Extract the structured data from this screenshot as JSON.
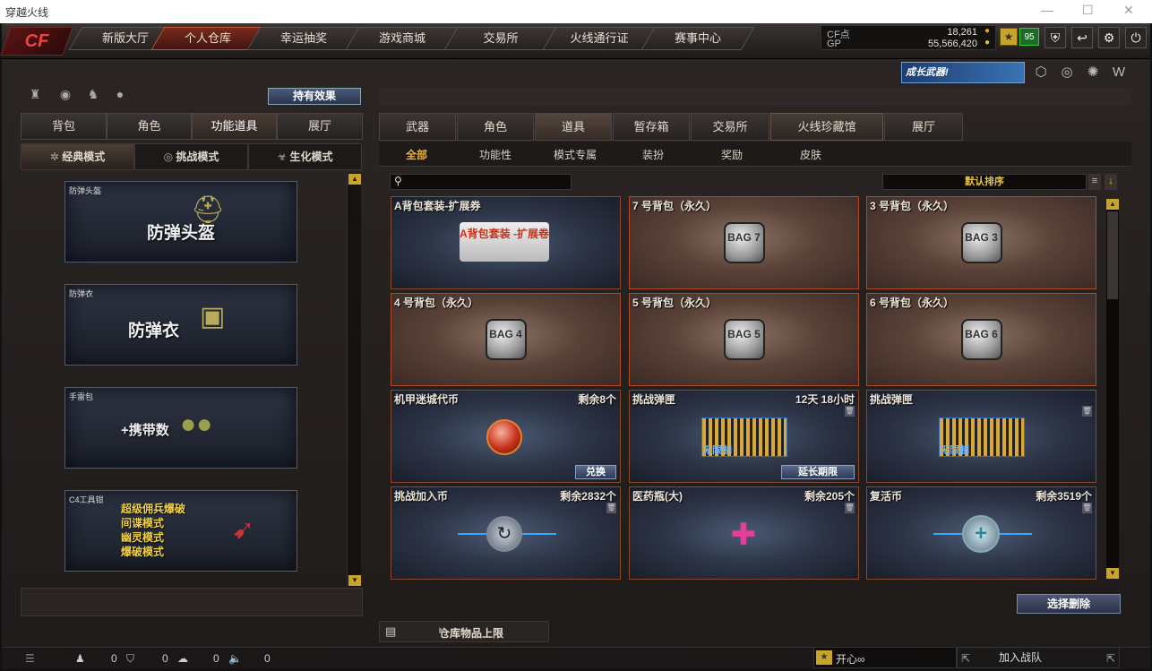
{
  "window": {
    "title": "穿越火线"
  },
  "logo": {
    "text": "CF"
  },
  "topnav": [
    "新版大厅",
    "个人仓库",
    "幸运抽奖",
    "游戏商城",
    "交易所",
    "火线通行证",
    "赛事中心"
  ],
  "currency": {
    "cf_label": "CF点",
    "cf_value": "18,261",
    "gp_label": "GP",
    "gp_value": "55,566,420"
  },
  "player": {
    "level": "95"
  },
  "banner": {
    "text": "成长武器!"
  },
  "left": {
    "hold_effects": "持有效果",
    "tabs": [
      "背包",
      "角色",
      "功能道具",
      "展厅"
    ],
    "modes": [
      "经典模式",
      "挑战模式",
      "生化模式"
    ],
    "cards": [
      {
        "small": "防弹头盔",
        "big": "防弹头盔"
      },
      {
        "small": "防弹衣",
        "big": "防弹衣"
      },
      {
        "small": "手雷包",
        "big": "+携带数"
      },
      {
        "small": "C4工具钳",
        "lines": [
          "超级佣兵爆破",
          "间谍模式",
          "幽灵模式",
          "爆破模式"
        ]
      }
    ]
  },
  "right": {
    "tabs": [
      "武器",
      "角色",
      "道具",
      "暂存箱",
      "交易所",
      "火线珍藏馆",
      "展厅"
    ],
    "subtabs": [
      "全部",
      "功能性",
      "模式专属",
      "装扮",
      "奖励",
      "皮肤"
    ],
    "sort": "默认排序",
    "items": [
      {
        "name": "A背包套装-扩展券",
        "remain": "",
        "img": "A背包套装 -扩展卷"
      },
      {
        "name": "7 号背包（永久）",
        "remain": "",
        "img": "BAG 7"
      },
      {
        "name": "3 号背包（永久）",
        "remain": "",
        "img": "BAG 3"
      },
      {
        "name": "4 号背包（永久）",
        "remain": "",
        "img": "BAG 4"
      },
      {
        "name": "5 号背包（永久）",
        "remain": "",
        "img": "BAG 5"
      },
      {
        "name": "6 号背包（永久）",
        "remain": "",
        "img": "BAG 6"
      },
      {
        "name": "机甲迷城代币",
        "remain": "剩余8个",
        "action": "兑换"
      },
      {
        "name": "挑战弹匣",
        "remain": "12天 18小时",
        "action": "延长期限",
        "img": "无限制"
      },
      {
        "name": "挑战弹匣",
        "remain": "",
        "img": "无限制"
      },
      {
        "name": "挑战加入币",
        "remain": "剩余2832个"
      },
      {
        "name": "医药瓶(大)",
        "remain": "剩余205个"
      },
      {
        "name": "复活币",
        "remain": "剩余3519个"
      }
    ],
    "delete_btn": "选择删除",
    "capacity": "仓库物品上限"
  },
  "status": {
    "c1": "0",
    "c2": "0",
    "c3": "0",
    "c4": "0",
    "mood": "开心∞",
    "join": "加入战队"
  }
}
